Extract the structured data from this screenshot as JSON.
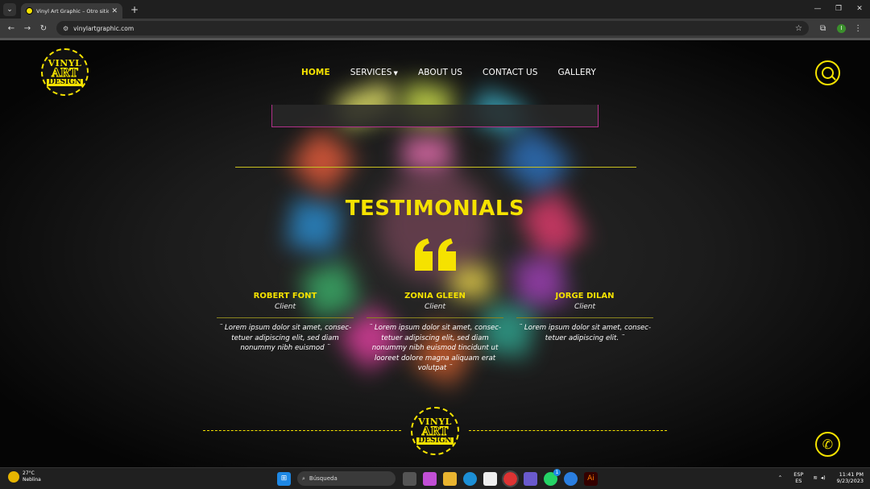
{
  "browser": {
    "tab_title": "Vinyl Art Graphic – Otro sitio r",
    "url": "vinylartgraphic.com",
    "new_tab_label": "+",
    "profile_initial": "I"
  },
  "site": {
    "logo": {
      "line1": "VINYL",
      "line2": "ART",
      "line3": "DESIGN"
    },
    "nav": [
      {
        "label": "HOME",
        "active": true
      },
      {
        "label": "SERVICES",
        "active": false
      },
      {
        "label": "ABOUT US",
        "active": false
      },
      {
        "label": "CONTACT US",
        "active": false
      },
      {
        "label": "GALLERY",
        "active": false
      }
    ],
    "section_title": "TESTIMONIALS",
    "testimonials": [
      {
        "name": "ROBERT FONT",
        "role": "Client",
        "text": "¨ Lorem ipsum dolor sit amet, consec-tetuer adipiscing elit, sed diam nonummy nibh euismod ¨"
      },
      {
        "name": "ZONIA GLEEN",
        "role": "Client",
        "text": "¨ Lorem ipsum dolor sit amet, consec-tetuer adipiscing elit, sed diam nonummy nibh euismod tincidunt ut looreet dolore magna aliquam erat volutpat ¨"
      },
      {
        "name": "JORGE DILAN",
        "role": "Client",
        "text": "¨ Lorem ipsum dolor sit amet, consec-tetuer adipiscing elit. ¨"
      }
    ],
    "accent_color": "#f5e200"
  },
  "taskbar": {
    "weather_temp": "27°C",
    "weather_desc": "Neblina",
    "search_placeholder": "Búsqueda",
    "lang_top": "ESP",
    "lang_bottom": "ES",
    "time": "11:41 PM",
    "date": "9/23/2023",
    "whatsapp_badge": "1"
  }
}
